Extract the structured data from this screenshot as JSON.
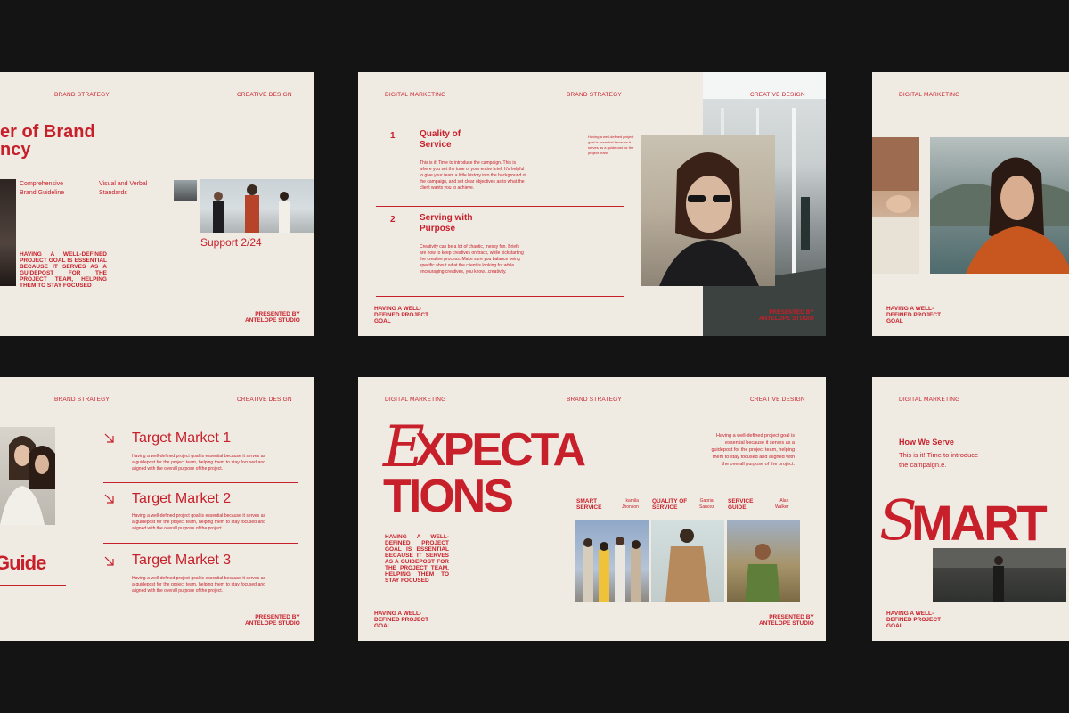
{
  "colors": {
    "background": "#141414",
    "slide": "#efeae2",
    "accent": "#c8202b"
  },
  "slide1": {
    "nav_left": "BRAND STRATEGY",
    "nav_right": "CREATIVE DESIGN",
    "title_line1": "er of Brand",
    "title_line2": "ncy",
    "col1": "Comprehensive\nBrand Guideline",
    "col2": "Visual and Verbal\nStandards",
    "support": "Support 2/24",
    "body": "HAVING A WELL-DEFINED PROJECT GOAL IS ESSENTIAL BECAUSE IT SERVES AS A GUIDEPOST FOR THE PROJECT TEAM, HELPING THEM TO STAY FOCUSED",
    "footer": "PRESENTED BY\nANTELOPE STUDIO"
  },
  "slide2": {
    "nav_left": "DIGITAL MARKETING",
    "nav_mid": "BRAND STRATEGY",
    "nav_right": "CREATIVE DESIGN",
    "item1_num": "1",
    "item1_title": "Quality of\nService",
    "item1_body": "This is it! Time to introduce the campaign. This is where you set the tone of your entire brief. It's helpful to give your team a little history into the background of the campaign, and set clear objectives as to what the client wants you to achieve.",
    "item2_num": "2",
    "item2_title": "Serving with\nPurpose",
    "item2_body": "Creativity can be a lot of chaotic, messy fun. Briefs are how to keep creatives on track, while kickstarting the creative process. Make sure you balance being specific about what the client is looking for while encouraging creatives, you know...creativity.",
    "side_note": "Having a well-defined project goal is essential because it serves as a guidepost for the project team.",
    "footer_left": "HAVING A WELL-\nDEFINED PROJECT\nGOAL",
    "footer_right": "PRESENTED BY\nANTELOPE STUDIO"
  },
  "slide3": {
    "nav_left": "DIGITAL MARKETING",
    "footer_left": "HAVING A WELL-\nDEFINED PROJECT\nGOAL"
  },
  "slide4": {
    "nav_left": "BRAND STRATEGY",
    "nav_right": "CREATIVE DESIGN",
    "targets": [
      {
        "title": "Target Market 1",
        "body": "Having a well-defined project goal is essential because it serves as a guidepost for the project team, helping them to stay focused and aligned with the overall purpose of the project."
      },
      {
        "title": "Target Market 2",
        "body": "Having a well-defined project goal is essential because it serves as a guidepost for the project team, helping them to stay focused and aligned with the overall purpose of the project."
      },
      {
        "title": "Target Market 3",
        "body": "Having a well-defined project goal is essential because it serves as a guidepost for the project team, helping them to stay focused and aligned with the overall purpose of the project."
      }
    ],
    "guide": "Guide",
    "footer": "PRESENTED BY\nANTELOPE STUDIO"
  },
  "slide5": {
    "nav_left": "DIGITAL MARKETING",
    "nav_mid": "BRAND STRATEGY",
    "nav_right": "CREATIVE DESIGN",
    "script_letter": "E",
    "title_line1": "XPECTA",
    "title_line2": "TIONS",
    "intro": "Having a well-defined project goal is essential because it serves as a guidepost for the project team, helping them to stay focused and aligned with the overall purpose of the project.",
    "labels": [
      {
        "title": "SMART\nSERVICE",
        "name": "kamila\nJhonson"
      },
      {
        "title": "QUALITY OF\nSERVICE",
        "name": "Gabrial\nSancez"
      },
      {
        "title": "SERVICE\nGUIDE",
        "name": "Alan\nWalker"
      }
    ],
    "body": "HAVING A WELL-DEFINED PROJECT GOAL IS ESSENTIAL BECAUSE IT SERVES AS A GUIDEPOST FOR THE PROJECT TEAM, HELPING THEM TO STAY FOCUSED",
    "footer_left": "HAVING A WELL-\nDEFINED PROJECT\nGOAL",
    "footer_right": "PRESENTED BY\nANTELOPE STUDIO"
  },
  "slide6": {
    "nav_left": "DIGITAL MARKETING",
    "heading": "How We Serve",
    "body": "This is it! Time to introduce\nthe campaign.e.",
    "script_letter": "S",
    "title": "MART",
    "footer_left": "HAVING A WELL-\nDEFINED PROJECT\nGOAL"
  }
}
